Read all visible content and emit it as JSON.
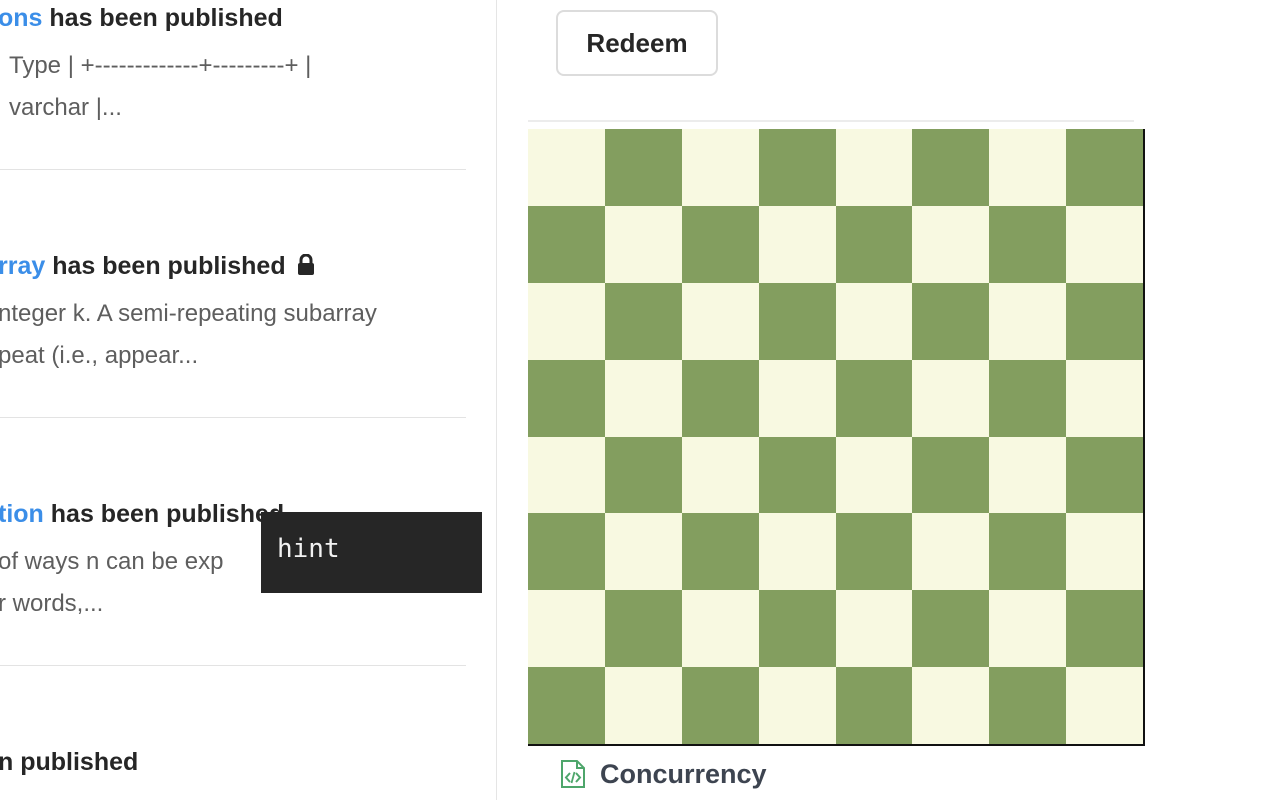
{
  "feed": {
    "items": [
      {
        "title_link": "ons",
        "title_rest": "has been published",
        "locked": false,
        "desc_lines": [
          "Type | +-------------+---------+ |",
          "varchar |..."
        ]
      },
      {
        "title_link": "rray",
        "title_rest": "has been published",
        "locked": true,
        "desc_lines": [
          "nteger k. A semi-repeating subarray",
          "peat (i.e., appear..."
        ]
      },
      {
        "title_link": "tion",
        "title_rest": "has been published",
        "locked": false,
        "desc_lines": [
          "of ways n can be exp",
          "r words,..."
        ]
      },
      {
        "title_link": "",
        "title_rest": "n published",
        "locked": false,
        "desc_lines": []
      }
    ]
  },
  "tooltip": {
    "text": "hint"
  },
  "right_panel": {
    "redeem_label": "Redeem",
    "chessboard": {
      "size": 8,
      "light_color": "#f8f9e1",
      "dark_color": "#839e5f"
    },
    "category": {
      "icon": "code-file-icon",
      "label": "Concurrency"
    }
  },
  "colors": {
    "link": "#3b8ee8",
    "title": "#262626",
    "description": "#5e5e5e",
    "tooltip_bg": "#262626"
  }
}
